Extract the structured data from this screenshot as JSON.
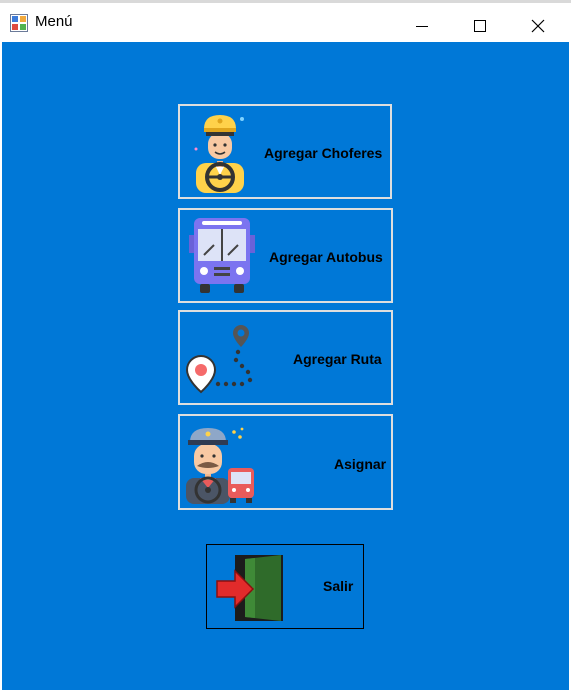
{
  "window": {
    "title": "Menú",
    "icon": "app-window-icon",
    "controls": [
      "minimize-icon",
      "maximize-icon",
      "close-icon"
    ]
  },
  "menu": {
    "buttons": [
      {
        "label": "Agregar Choferes",
        "icon": "driver-icon"
      },
      {
        "label": "Agregar Autobus",
        "icon": "bus-icon"
      },
      {
        "label": "Agregar Ruta",
        "icon": "route-pin-icon"
      },
      {
        "label": "Asignar",
        "icon": "conductor-bus-icon"
      }
    ],
    "exit": {
      "label": "Salir",
      "icon": "exit-door-icon"
    }
  },
  "colors": {
    "background": "#0078d7",
    "button_border": "#dedede",
    "titlebar": "#ffffff"
  }
}
